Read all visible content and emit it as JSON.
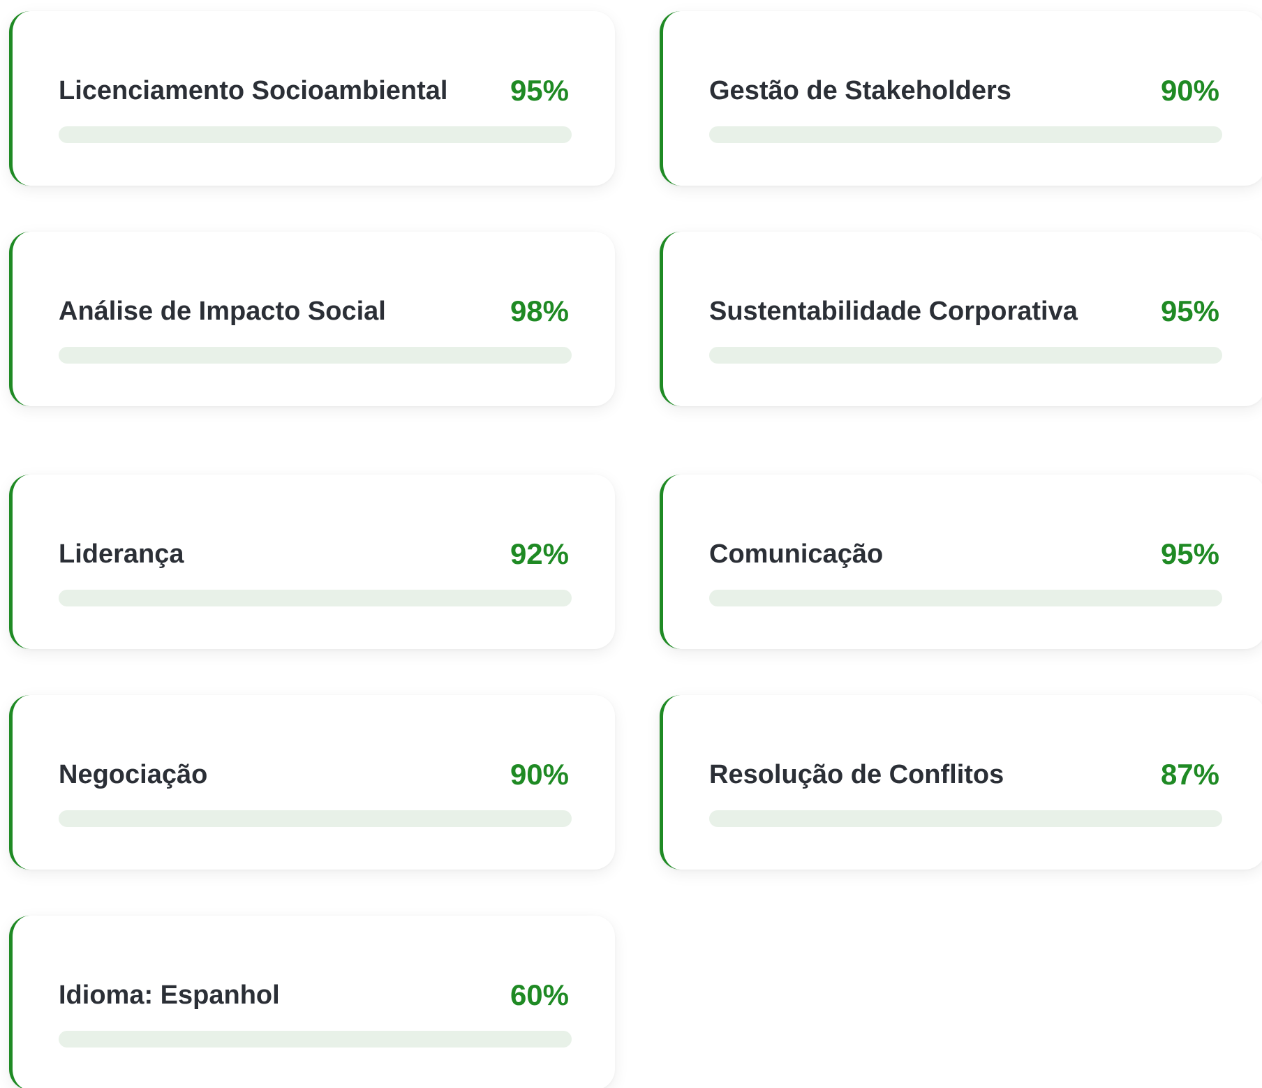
{
  "colors": {
    "accent": "#1f8a24",
    "track": "#e8f1e8",
    "text": "#2b2f36",
    "card_background": "#ffffff"
  },
  "skills": [
    {
      "label": "Licenciamento Socioambiental",
      "value_text": "95%",
      "level": 95
    },
    {
      "label": "Gestão de Stakeholders",
      "value_text": "90%",
      "level": 90
    },
    {
      "label": "Análise de Impacto Social",
      "value_text": "98%",
      "level": 98
    },
    {
      "label": "Sustentabilidade Corporativa",
      "value_text": "95%",
      "level": 95
    },
    {
      "label": "Liderança",
      "value_text": "92%",
      "level": 92
    },
    {
      "label": "Comunicação",
      "value_text": "95%",
      "level": 95
    },
    {
      "label": "Negociação",
      "value_text": "90%",
      "level": 90
    },
    {
      "label": "Resolução de Conflitos",
      "value_text": "87%",
      "level": 87
    },
    {
      "label": "Idioma: Espanhol",
      "value_text": "60%",
      "level": 60
    }
  ]
}
